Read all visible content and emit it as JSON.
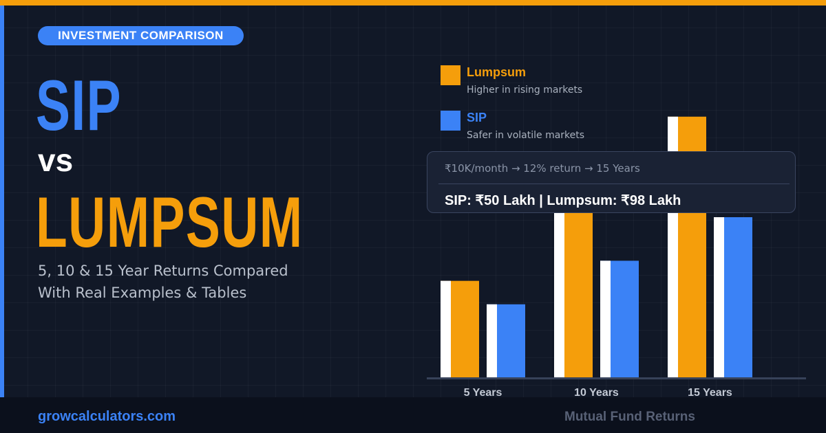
{
  "badge": "INVESTMENT COMPARISON",
  "title": {
    "line1": "SIP",
    "line2": "vs",
    "line3": "LUMPSUM"
  },
  "subtitle": {
    "line1": "5, 10 & 15 Year Returns Compared",
    "line2": "With Real Examples & Tables"
  },
  "info": {
    "inputs": "₹10K/month  →  12% return  →  15 Years",
    "result": "SIP: ₹50 Lakh   |   Lumpsum: ₹98 Lakh"
  },
  "footer": {
    "site": "growcalculators.com",
    "tag": "Mutual Fund Returns"
  },
  "colors": {
    "lumpsum": "#f59e0b",
    "sip": "#3b82f6",
    "accent": "#3b82f6"
  },
  "chart_data": {
    "type": "bar",
    "categories": [
      "5 Years",
      "10 Years",
      "15 Years"
    ],
    "series": [
      {
        "name": "Lumpsum",
        "description": "Higher in rising markets",
        "color": "#f59e0b",
        "values": [
          145,
          280,
          390
        ]
      },
      {
        "name": "SIP",
        "description": "Safer in volatile markets",
        "color": "#3b82f6",
        "values": [
          110,
          175,
          240
        ]
      }
    ],
    "ylim": [
      0,
      400
    ],
    "grid": false,
    "legend": "top-left",
    "title": "",
    "xlabel": "",
    "ylabel": ""
  }
}
